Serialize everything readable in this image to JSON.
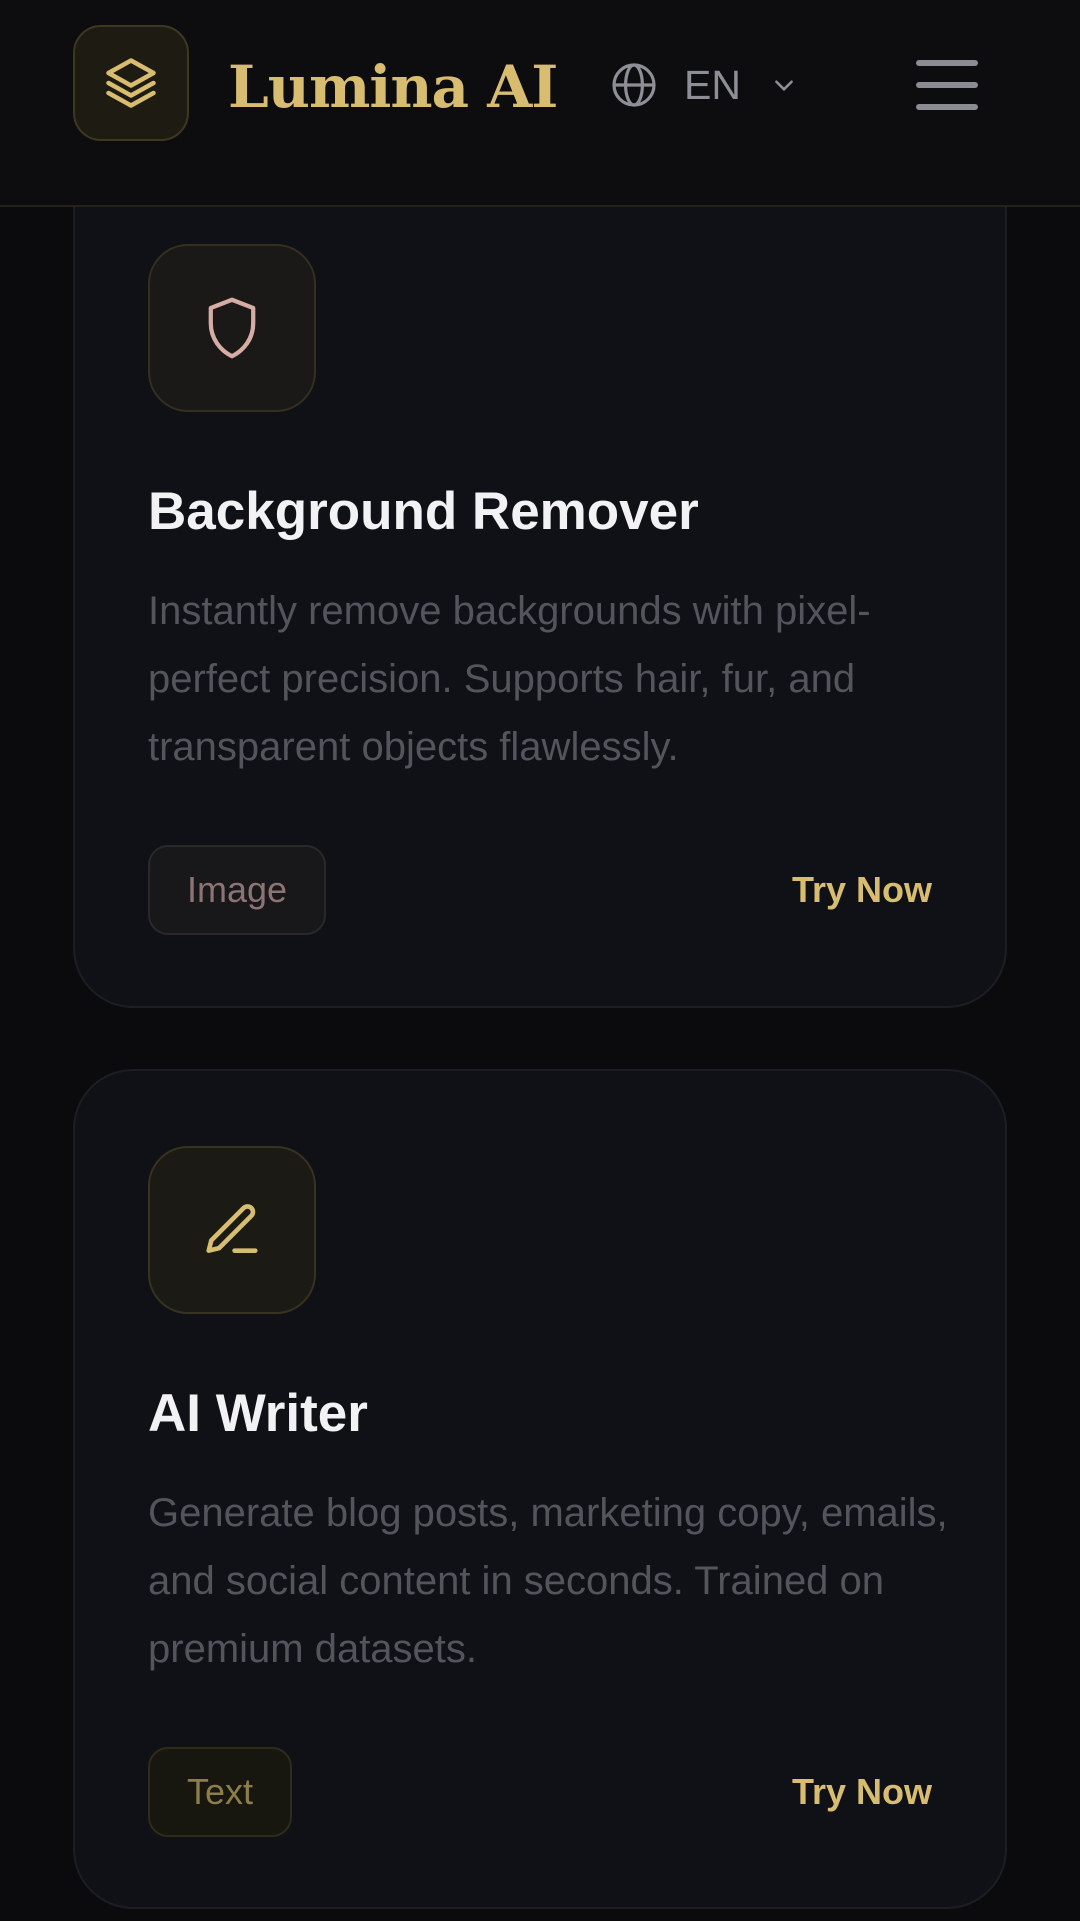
{
  "header": {
    "brand": "Lumina AI",
    "language": "EN",
    "icons": {
      "logo": "layers-icon",
      "language": "globe-icon",
      "dropdown": "chevron-down-icon",
      "menu": "menu-icon"
    }
  },
  "cards": [
    {
      "icon": "shield-icon",
      "title": "Background Remover",
      "description": "Instantly remove backgrounds with pixel-perfect precision. Supports hair, fur, and transparent objects flawlessly.",
      "tag": "Image",
      "cta": "Try Now"
    },
    {
      "icon": "pen-icon",
      "title": "AI Writer",
      "description": "Generate blog posts, marketing copy, emails, and social content in seconds. Trained on premium datasets.",
      "tag": "Text",
      "cta": "Try Now"
    }
  ],
  "colors": {
    "accent": "#d8bd70",
    "background": "#0b0b0e",
    "card": "#101116",
    "shield_icon": "#d6aca4"
  }
}
